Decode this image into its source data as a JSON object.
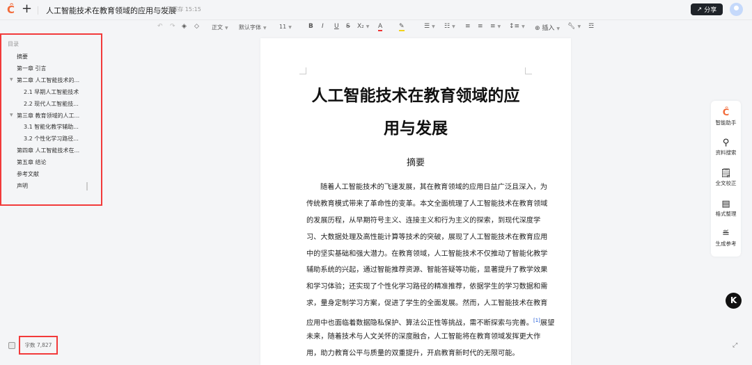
{
  "header": {
    "title": "人工智能技术在教育领域的应用与发展",
    "saved": "已保存 15:15",
    "share_label": "分享"
  },
  "toolbar": {
    "style": "正文",
    "font": "默认字体",
    "size": "11",
    "insert": "插入"
  },
  "outline": {
    "title": "目录",
    "items": [
      {
        "label": "摘要",
        "level": 1
      },
      {
        "label": "第一章 引言",
        "level": 1
      },
      {
        "label": "第二章 人工智能技术的...",
        "level": 1,
        "expandable": true
      },
      {
        "label": "2.1 早期人工智能技术",
        "level": 2
      },
      {
        "label": "2.2 现代人工智能技...",
        "level": 2
      },
      {
        "label": "第三章 教育领域的人工...",
        "level": 1,
        "expandable": true
      },
      {
        "label": "3.1 智能化教学辅助...",
        "level": 2
      },
      {
        "label": "3.2 个性化学习路径...",
        "level": 2
      },
      {
        "label": "第四章 人工智能技术在...",
        "level": 1
      },
      {
        "label": "第五章 结论",
        "level": 1
      },
      {
        "label": "参考文献",
        "level": 1
      },
      {
        "label": "声明",
        "level": 1
      }
    ]
  },
  "document": {
    "title_lines": [
      "人工智能技术在教育领域的应",
      "用与发展"
    ],
    "section": "摘要",
    "lines": [
      "随着人工智能技术的飞速发展，其在教育领域的应用日益广泛且深入，为",
      "传统教育模式带来了革命性的变革。本文全面梳理了人工智能技术在教育领域",
      "的发展历程，从早期符号主义、连接主义和行为主义的探索，到现代深度学",
      "习、大数据处理及高性能计算等技术的突破，展现了人工智能技术在教育应用",
      "中的坚实基础和强大潜力。在教育领域，人工智能技术不仅推动了智能化教学",
      "辅助系统的兴起，通过智能推荐资源、智能答疑等功能，显著提升了教学效果",
      "和学习体验；还实现了个性化学习路径的精准推荐，依据学生的学习数据和需",
      "求，量身定制学习方案，促进了学生的全面发展。然而，人工智能技术在教育",
      "应用中也面临着数据隐私保护、算法公正性等挑战，需不断探索与完善。",
      "未来，随着技术与人文关怀的深度融合，人工智能将在教育领域发挥更大作",
      "用，助力教育公平与质量的双重提升，开启教育新时代的无限可能。"
    ],
    "citation": "[1]",
    "after_citation": "展望"
  },
  "right_panel": {
    "items": [
      "智能助手",
      "资料搜索",
      "全文校正",
      "格式整理",
      "生成参考"
    ]
  },
  "footer": {
    "word_count": "字数 7,827"
  },
  "colors": {
    "accent": "#f26b3a",
    "highlight_box": "#f23a3a"
  }
}
